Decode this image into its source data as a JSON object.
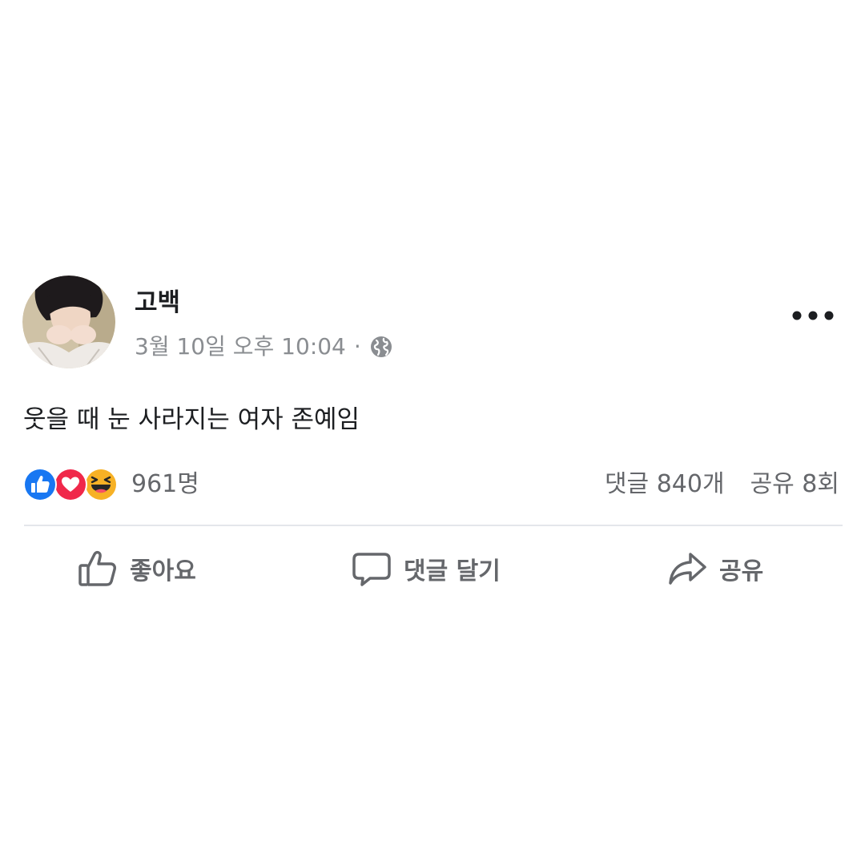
{
  "post": {
    "author": "고백",
    "timestamp": "3월 10일 오후 10:04",
    "separator": "·",
    "privacy_icon": "globe-icon",
    "more_icon": "ellipsis-icon",
    "text": "웃을 때 눈 사라지는 여자 존예임"
  },
  "stats": {
    "reaction_icons": [
      "like-reaction-icon",
      "love-reaction-icon",
      "haha-reaction-icon"
    ],
    "reaction_count": "961명",
    "comments": "댓글 840개",
    "shares": "공유 8회"
  },
  "actions": {
    "like_label": "좋아요",
    "comment_label": "댓글 달기",
    "share_label": "공유"
  },
  "colors": {
    "like_blue": "#1877f2",
    "love_red": "#f0284a",
    "haha_yellow": "#f7b125",
    "muted_text": "#65676b",
    "meta_text": "#8a8d91",
    "divider": "#e4e6eb"
  }
}
